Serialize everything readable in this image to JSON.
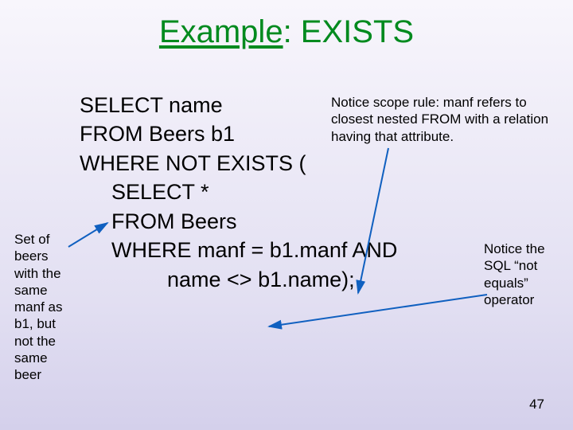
{
  "title": {
    "underlined": "Example",
    "rest": ": EXISTS"
  },
  "code": {
    "l1": "SELECT name",
    "l2": "FROM Beers b1",
    "l3": "WHERE NOT EXISTS (",
    "l4": "SELECT *",
    "l5": "FROM Beers",
    "l6": "WHERE manf = b1.manf AND",
    "l7": "name <> b1.name);"
  },
  "notes": {
    "scope": "Notice scope rule: manf refers to closest nested FROM with a relation having that attribute.",
    "left": "Set of beers with the same manf as b1, but not the same beer",
    "right": "Notice the SQL “not equals” operator"
  },
  "page": "47"
}
